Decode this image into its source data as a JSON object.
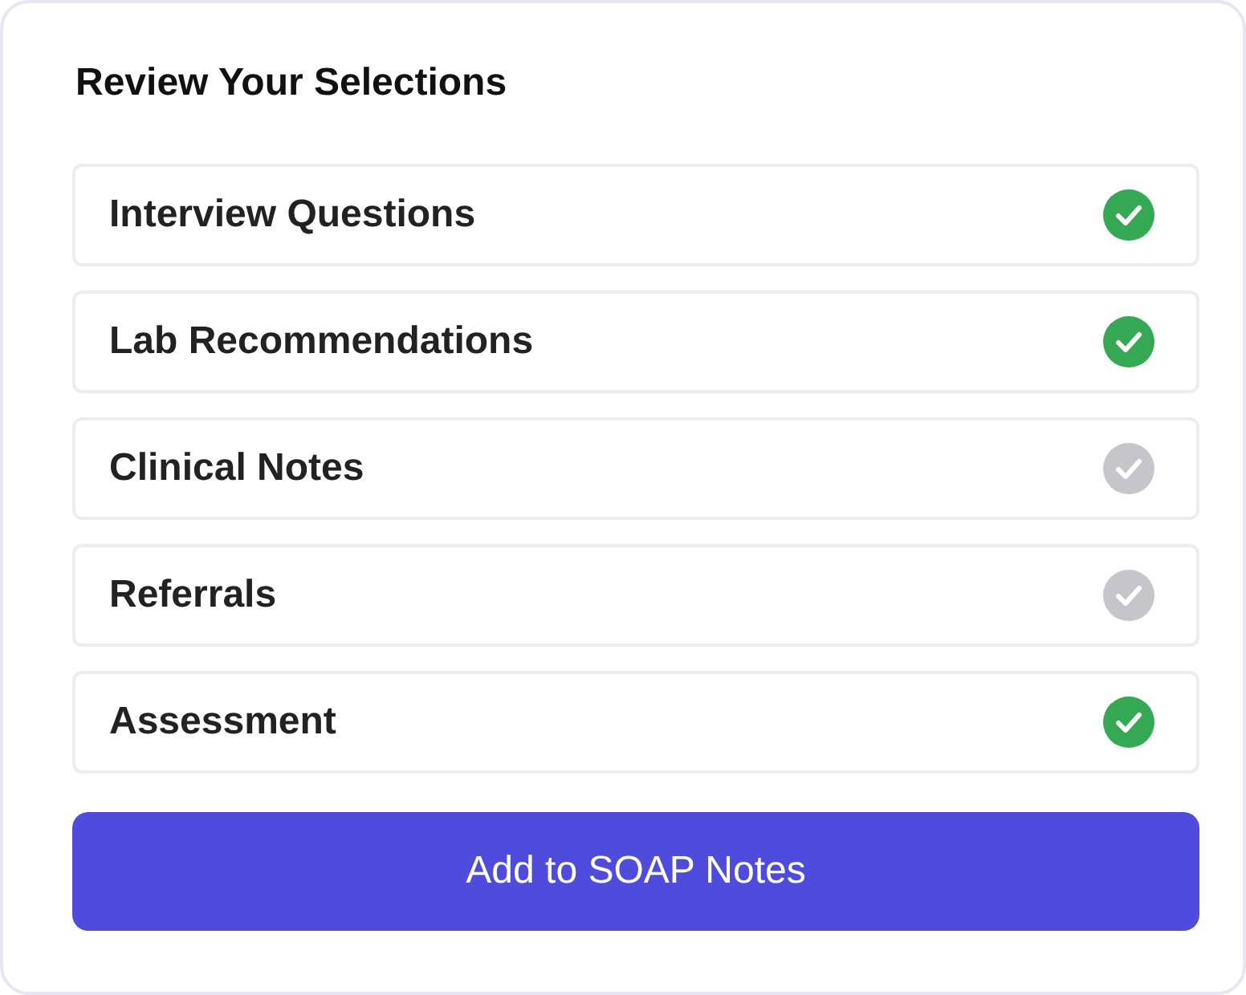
{
  "title": "Review Your Selections",
  "items": [
    {
      "label": "Interview Questions",
      "checked": true
    },
    {
      "label": "Lab Recommendations",
      "checked": true
    },
    {
      "label": "Clinical Notes",
      "checked": false
    },
    {
      "label": "Referrals",
      "checked": false
    },
    {
      "label": "Assessment",
      "checked": true
    }
  ],
  "button": "Add to SOAP Notes"
}
